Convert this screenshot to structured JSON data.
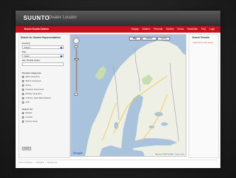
{
  "header": {
    "logo_text": "SUUNTO",
    "page_heading": "Dealer Locator"
  },
  "navbar": {
    "left_label": "Search Suunto Dealers",
    "links": [
      "Display",
      "Dealers",
      "Personal",
      "Dealers",
      "Divers",
      "Essentials",
      "FAQ",
      "Login"
    ]
  },
  "search_panel": {
    "title": "Search for Suunto Representatives",
    "country_label": "Country",
    "country_value": "Finland",
    "city_label": "City",
    "city_value": "Select",
    "zip_label": "Zip / Postal codes",
    "zip_value": "",
    "categories_label": "Product categories",
    "categories": [
      "Wrist Computers",
      "Marine Computers",
      "Diving",
      "Precision Instruments",
      "Wristop Computers",
      "Training / Heart Rate Monitors",
      "GPS"
    ],
    "search_for_label": "Search for:",
    "search_for_options": [
      "Retailer",
      "Importer",
      "Service center"
    ],
    "search_button": "Search"
  },
  "map": {
    "type_buttons": [
      "Map",
      "Satellite",
      "Hybrid"
    ],
    "zoom_in": "+",
    "zoom_out": "−",
    "zoom_level_fraction": 0.22,
    "logo": "Google",
    "attribution": "Map data ©2009 Tele Atlas · Terms of Use",
    "colors": {
      "water": "#a9c3dd",
      "land": "#eef0e6",
      "forest": "#c9dcae",
      "route": "#f0c848",
      "border": "#a08fb0"
    }
  },
  "results": {
    "title": "Search Results",
    "empty_text": "Select first in the search"
  },
  "footer": {
    "links": [
      "Terms of Privacy",
      "All Rights",
      "Suunto.com"
    ],
    "separator": "|"
  },
  "colors": {
    "brand_red": "#c8101a",
    "header_dark": "#2f2f2f"
  }
}
